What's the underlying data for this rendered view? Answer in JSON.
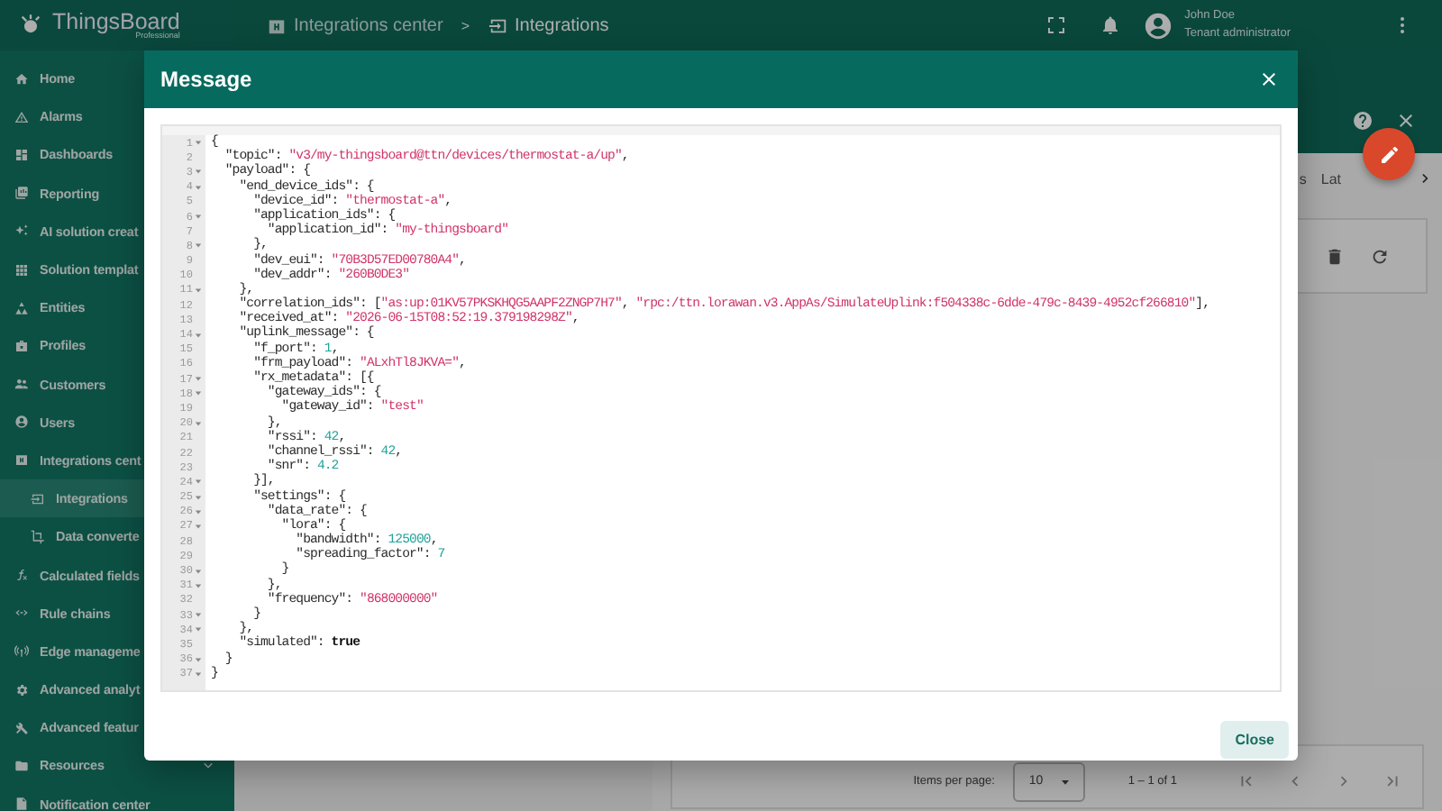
{
  "topbar": {
    "logo": {
      "name": "ThingsBoard",
      "edition": "Professional"
    },
    "separator": ">",
    "breadcrumbs": [
      {
        "label": "Integrations center",
        "selected": false
      },
      {
        "label": "Integrations",
        "selected": true
      }
    ],
    "user": {
      "name": "John Doe",
      "role": "Tenant administrator"
    }
  },
  "sidebar": {
    "items": [
      {
        "label": "Home",
        "kind": "home",
        "selected": false
      },
      {
        "label": "Alarms",
        "kind": "alarm",
        "selected": false
      },
      {
        "label": "Dashboards",
        "kind": "dashboard",
        "selected": false
      },
      {
        "label": "Reporting",
        "kind": "report",
        "selected": false
      },
      {
        "label": "AI solution creat",
        "kind": "ai",
        "selected": false
      },
      {
        "label": "Solution templat",
        "kind": "templates",
        "selected": false
      },
      {
        "label": "Entities",
        "kind": "entities",
        "selected": false
      },
      {
        "label": "Profiles",
        "kind": "profiles",
        "selected": false
      },
      {
        "label": "Customers",
        "kind": "customers",
        "selected": false
      },
      {
        "label": "Users",
        "kind": "users",
        "selected": false
      },
      {
        "label": "Integrations cent",
        "kind": "integrations_center",
        "selected": false,
        "expanded": true,
        "children": [
          {
            "label": "Integrations",
            "kind": "integrations",
            "selected": true
          },
          {
            "label": "Data converte",
            "kind": "converters",
            "selected": false
          }
        ]
      },
      {
        "label": "Calculated fields",
        "kind": "calculated",
        "selected": false
      },
      {
        "label": "Rule chains",
        "kind": "rules",
        "selected": false
      },
      {
        "label": "Edge manageme",
        "kind": "edge",
        "selected": false
      },
      {
        "label": "Advanced analyt",
        "kind": "analytics",
        "selected": false
      },
      {
        "label": "Advanced featur",
        "kind": "features",
        "selected": false
      },
      {
        "label": "Resources",
        "kind": "resources",
        "selected": false,
        "expanded": false
      },
      {
        "label": "Notification center",
        "kind": "notifications",
        "selected": false
      }
    ]
  },
  "details": {
    "tabs": [
      {
        "label": "s",
        "selected": false
      },
      {
        "label": "Lat",
        "selected": false
      }
    ]
  },
  "pagination": {
    "label": "Items per page:",
    "page_size": "10",
    "range": "1 – 1 of 1"
  },
  "dialog": {
    "title": "Message",
    "button": "Close",
    "lines": [
      {
        "number": "1",
        "fold": true,
        "tokens": [
          {
            "kind": "plain",
            "text": "{"
          }
        ]
      },
      {
        "number": "2",
        "fold": false,
        "tokens": [
          {
            "kind": "key",
            "text": "  \"topic\": "
          },
          {
            "kind": "str",
            "text": "\"v3/my-thingsboard@ttn/devices/thermostat-a/up\""
          },
          {
            "kind": "plain",
            "text": ","
          }
        ]
      },
      {
        "number": "3",
        "fold": true,
        "tokens": [
          {
            "kind": "key",
            "text": "  \"payload\": {"
          }
        ]
      },
      {
        "number": "4",
        "fold": true,
        "tokens": [
          {
            "kind": "key",
            "text": "    \"end_device_ids\": {"
          }
        ]
      },
      {
        "number": "5",
        "fold": false,
        "tokens": [
          {
            "kind": "key",
            "text": "      \"device_id\": "
          },
          {
            "kind": "str",
            "text": "\"thermostat-a\""
          },
          {
            "kind": "plain",
            "text": ","
          }
        ]
      },
      {
        "number": "6",
        "fold": true,
        "tokens": [
          {
            "kind": "key",
            "text": "      \"application_ids\": {"
          }
        ]
      },
      {
        "number": "7",
        "fold": false,
        "tokens": [
          {
            "kind": "key",
            "text": "        \"application_id\": "
          },
          {
            "kind": "str",
            "text": "\"my-thingsboard\""
          }
        ]
      },
      {
        "number": "8",
        "fold": true,
        "tokens": [
          {
            "kind": "plain",
            "text": "      },"
          }
        ]
      },
      {
        "number": "9",
        "fold": false,
        "tokens": [
          {
            "kind": "key",
            "text": "      \"dev_eui\": "
          },
          {
            "kind": "str",
            "text": "\"70B3D57ED00780A4\""
          },
          {
            "kind": "plain",
            "text": ","
          }
        ]
      },
      {
        "number": "10",
        "fold": false,
        "tokens": [
          {
            "kind": "key",
            "text": "      \"dev_addr\": "
          },
          {
            "kind": "str",
            "text": "\"260B0DE3\""
          }
        ]
      },
      {
        "number": "11",
        "fold": true,
        "tokens": [
          {
            "kind": "plain",
            "text": "    },"
          }
        ]
      },
      {
        "number": "12",
        "fold": false,
        "tokens": [
          {
            "kind": "key",
            "text": "    \"correlation_ids\": ["
          },
          {
            "kind": "str",
            "text": "\"as:up:01KV57PKSKHQG5AAPF2ZNGP7H7\""
          },
          {
            "kind": "plain",
            "text": ", "
          },
          {
            "kind": "str",
            "text": "\"rpc:/ttn.lorawan.v3.AppAs/SimulateUplink:f504338c-6dde-479c-8439-4952cf266810\""
          },
          {
            "kind": "plain",
            "text": "],"
          }
        ]
      },
      {
        "number": "13",
        "fold": false,
        "tokens": [
          {
            "kind": "key",
            "text": "    \"received_at\": "
          },
          {
            "kind": "str",
            "text": "\"2026-06-15T08:52:19.379198298Z\""
          },
          {
            "kind": "plain",
            "text": ","
          }
        ]
      },
      {
        "number": "14",
        "fold": true,
        "tokens": [
          {
            "kind": "key",
            "text": "    \"uplink_message\": {"
          }
        ]
      },
      {
        "number": "15",
        "fold": false,
        "tokens": [
          {
            "kind": "key",
            "text": "      \"f_port\": "
          },
          {
            "kind": "num",
            "text": "1"
          },
          {
            "kind": "plain",
            "text": ","
          }
        ]
      },
      {
        "number": "16",
        "fold": false,
        "tokens": [
          {
            "kind": "key",
            "text": "      \"frm_payload\": "
          },
          {
            "kind": "str",
            "text": "\"ALxhTl8JKVA=\""
          },
          {
            "kind": "plain",
            "text": ","
          }
        ]
      },
      {
        "number": "17",
        "fold": true,
        "tokens": [
          {
            "kind": "key",
            "text": "      \"rx_metadata\": [{"
          }
        ]
      },
      {
        "number": "18",
        "fold": true,
        "tokens": [
          {
            "kind": "key",
            "text": "        \"gateway_ids\": {"
          }
        ]
      },
      {
        "number": "19",
        "fold": false,
        "tokens": [
          {
            "kind": "key",
            "text": "          \"gateway_id\": "
          },
          {
            "kind": "str",
            "text": "\"test\""
          }
        ]
      },
      {
        "number": "20",
        "fold": true,
        "tokens": [
          {
            "kind": "plain",
            "text": "        },"
          }
        ]
      },
      {
        "number": "21",
        "fold": false,
        "tokens": [
          {
            "kind": "key",
            "text": "        \"rssi\": "
          },
          {
            "kind": "num",
            "text": "42"
          },
          {
            "kind": "plain",
            "text": ","
          }
        ]
      },
      {
        "number": "22",
        "fold": false,
        "tokens": [
          {
            "kind": "key",
            "text": "        \"channel_rssi\": "
          },
          {
            "kind": "num",
            "text": "42"
          },
          {
            "kind": "plain",
            "text": ","
          }
        ]
      },
      {
        "number": "23",
        "fold": false,
        "tokens": [
          {
            "kind": "key",
            "text": "        \"snr\": "
          },
          {
            "kind": "num",
            "text": "4.2"
          }
        ]
      },
      {
        "number": "24",
        "fold": true,
        "tokens": [
          {
            "kind": "plain",
            "text": "      }],"
          }
        ]
      },
      {
        "number": "25",
        "fold": true,
        "tokens": [
          {
            "kind": "key",
            "text": "      \"settings\": {"
          }
        ]
      },
      {
        "number": "26",
        "fold": true,
        "tokens": [
          {
            "kind": "key",
            "text": "        \"data_rate\": {"
          }
        ]
      },
      {
        "number": "27",
        "fold": true,
        "tokens": [
          {
            "kind": "key",
            "text": "          \"lora\": {"
          }
        ]
      },
      {
        "number": "28",
        "fold": false,
        "tokens": [
          {
            "kind": "key",
            "text": "            \"bandwidth\": "
          },
          {
            "kind": "num",
            "text": "125000"
          },
          {
            "kind": "plain",
            "text": ","
          }
        ]
      },
      {
        "number": "29",
        "fold": false,
        "tokens": [
          {
            "kind": "key",
            "text": "            \"spreading_factor\": "
          },
          {
            "kind": "num",
            "text": "7"
          }
        ]
      },
      {
        "number": "30",
        "fold": true,
        "tokens": [
          {
            "kind": "plain",
            "text": "          }"
          }
        ]
      },
      {
        "number": "31",
        "fold": true,
        "tokens": [
          {
            "kind": "plain",
            "text": "        },"
          }
        ]
      },
      {
        "number": "32",
        "fold": false,
        "tokens": [
          {
            "kind": "key",
            "text": "        \"frequency\": "
          },
          {
            "kind": "str",
            "text": "\"868000000\""
          }
        ]
      },
      {
        "number": "33",
        "fold": true,
        "tokens": [
          {
            "kind": "plain",
            "text": "      }"
          }
        ]
      },
      {
        "number": "34",
        "fold": true,
        "tokens": [
          {
            "kind": "plain",
            "text": "    },"
          }
        ]
      },
      {
        "number": "35",
        "fold": false,
        "tokens": [
          {
            "kind": "key",
            "text": "    \"simulated\": "
          },
          {
            "kind": "bool",
            "text": "true"
          }
        ]
      },
      {
        "number": "36",
        "fold": true,
        "tokens": [
          {
            "kind": "plain",
            "text": "  }"
          }
        ]
      },
      {
        "number": "37",
        "fold": true,
        "tokens": [
          {
            "kind": "plain",
            "text": "}"
          }
        ]
      }
    ]
  }
}
